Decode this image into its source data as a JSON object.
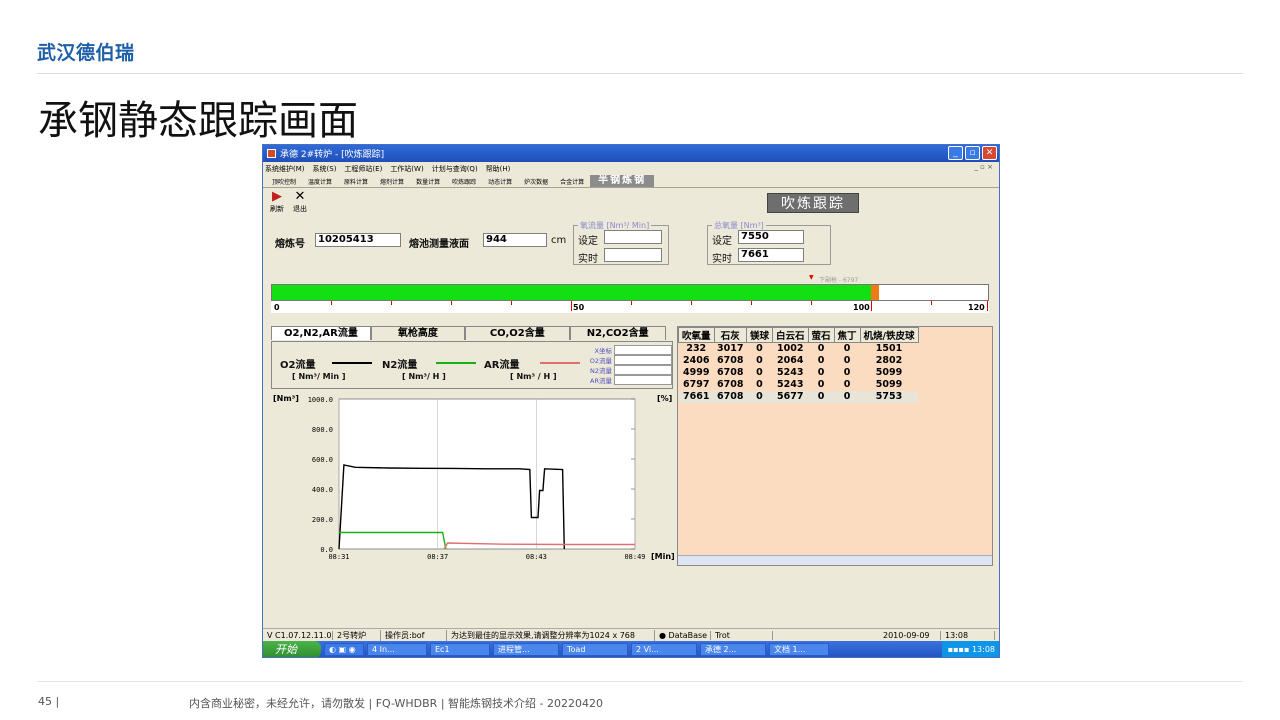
{
  "slide": {
    "brand": "武汉德伯瑞",
    "title": "承钢静态跟踪画面",
    "page_number": "45",
    "page_sep": "|",
    "footer": "内含商业秘密，未经允许，请勿散发 | FQ-WHDBR | 智能炼钢技术介绍 - 20220420"
  },
  "window": {
    "title": "承德 2#转炉 - [吹炼跟踪]",
    "menu": [
      "系统维护(M)",
      "系统(S)",
      "工程师站(E)",
      "工作站(W)",
      "计划与查询(Q)",
      "帮助(H)"
    ],
    "menu_right": "_ ▫ ×",
    "tabs": [
      "顶吹控制",
      "温度计算",
      "原料计算",
      "熔剂计算",
      "数量计算",
      "吹炼跟踪",
      "动态计算",
      "炉次数据",
      "合金计算"
    ],
    "active_tab": "半钢炼钢",
    "tools": [
      {
        "icon": "▶",
        "label": "刷新"
      },
      {
        "icon": "✕",
        "label": "退出"
      }
    ],
    "banner": "吹炼跟踪",
    "heat_no_label": "熔炼号",
    "heat_no": "10205413",
    "bath_level_label": "熔池测量液面",
    "bath_level": "944",
    "bath_level_unit": "cm",
    "oxygen_flow": {
      "legend": "氧流量 [Nm³/ Min]",
      "set_label": "设定",
      "set_value": "",
      "real_label": "实时",
      "real_value": ""
    },
    "total_oxygen": {
      "legend": "总氧量 [Nm³]",
      "set_label": "设定",
      "set_value": "7550",
      "real_label": "实时",
      "real_value": "7661"
    },
    "progress": {
      "value": 7661,
      "max": 7550,
      "green_pct": 0.836,
      "orange_pct": 0.012,
      "ticks": [
        "0",
        "50",
        "100",
        "120"
      ],
      "marker_label": "下副枪 - 6797"
    },
    "chart_tabs": [
      "O2,N2,AR流量",
      "氧枪高度",
      "CO,O2含量",
      "N2,CO2含量"
    ],
    "legend": {
      "o2": "O2流量",
      "o2_unit": "[ Nm³/ Min ]",
      "n2": "N2流量",
      "n2_unit": "[ Nm³/ H ]",
      "ar": "AR流量",
      "ar_unit": "[ Nm³ / H ]",
      "readout": [
        "X坐标",
        "O2流量",
        "N2流量",
        "AR流量"
      ]
    },
    "y_unit": "[Nm³]",
    "y2_unit": "[%]",
    "x_unit": "[Min]",
    "table": {
      "headers": [
        "吹氧量",
        "石灰",
        "镁球",
        "白云石",
        "萤石",
        "焦丁",
        "机烧/铁皮球"
      ],
      "rows": [
        [
          "232",
          "3017",
          "0",
          "1002",
          "0",
          "0",
          "1501"
        ],
        [
          "2406",
          "6708",
          "0",
          "2064",
          "0",
          "0",
          "2802"
        ],
        [
          "4999",
          "6708",
          "0",
          "5243",
          "0",
          "0",
          "5099"
        ],
        [
          "6797",
          "6708",
          "0",
          "5243",
          "0",
          "0",
          "5099"
        ],
        [
          "7661",
          "6708",
          "0",
          "5677",
          "0",
          "0",
          "5753"
        ]
      ]
    },
    "status": [
      "V C1.07.12.11.01",
      "2号转炉",
      "操作员:bof",
      "为达到最佳的显示效果,请调整分辨率为1024 x 768",
      "● DataBase",
      "Trot",
      "",
      "2010-09-09",
      "13:08"
    ],
    "taskbar": {
      "start": "开始",
      "tasks": [
        "4 In...",
        "Ec1",
        "进程管...",
        "Toad",
        "2 Vi...",
        "承德 2...",
        "文档 1..."
      ],
      "clock": "13:08"
    }
  },
  "chart_data": {
    "type": "line",
    "x_ticks": [
      "08:31",
      "08:37",
      "08:43",
      "08:49"
    ],
    "y_ticks": [
      "1000.0",
      "800.0",
      "600.0",
      "400.0",
      "200.0",
      "0.0"
    ],
    "ylim": [
      0,
      1000
    ],
    "xlim": [
      0,
      18
    ],
    "series": [
      {
        "name": "O2流量",
        "color": "#000000",
        "points": [
          [
            0,
            0
          ],
          [
            0.3,
            560
          ],
          [
            1,
            545
          ],
          [
            3,
            540
          ],
          [
            5,
            538
          ],
          [
            7,
            537
          ],
          [
            9,
            535
          ],
          [
            11,
            535
          ],
          [
            11.6,
            530
          ],
          [
            11.7,
            210
          ],
          [
            12.1,
            210
          ],
          [
            12.2,
            390
          ],
          [
            12.4,
            390
          ],
          [
            12.5,
            535
          ],
          [
            13.6,
            530
          ],
          [
            13.7,
            0
          ]
        ]
      },
      {
        "name": "N2流量",
        "color": "#18b018",
        "points": [
          [
            0,
            110
          ],
          [
            6.3,
            110
          ],
          [
            6.5,
            0
          ]
        ]
      },
      {
        "name": "AR流量",
        "color": "#e07070",
        "points": [
          [
            6.4,
            0
          ],
          [
            6.6,
            40
          ],
          [
            10,
            32
          ],
          [
            14,
            30
          ],
          [
            18,
            30
          ]
        ]
      }
    ]
  }
}
